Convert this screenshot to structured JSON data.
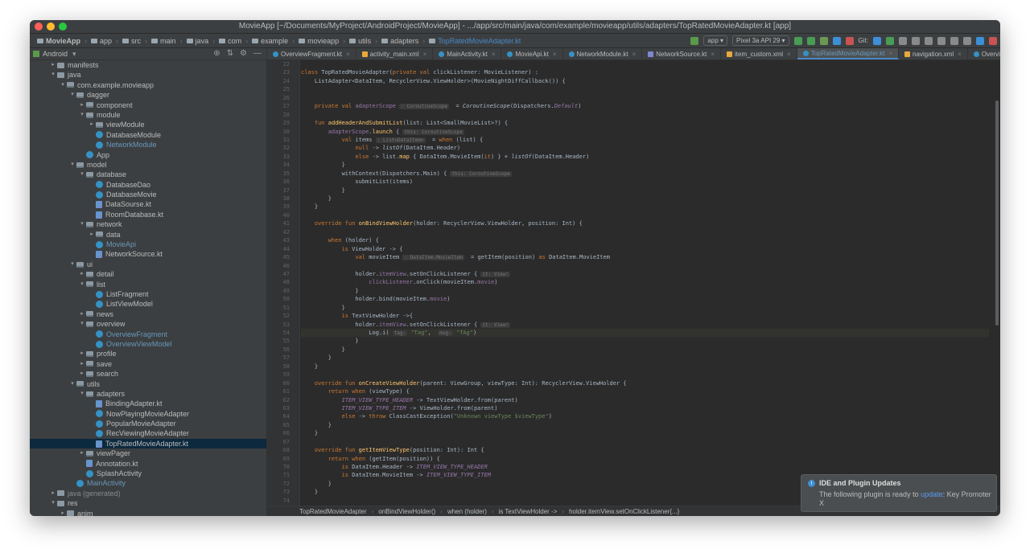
{
  "window": {
    "title": "MovieApp [~/Documents/MyProject/AndroidProject/MovieApp] - .../app/src/main/java/com/example/movieapp/utils/adapters/TopRatedMovieAdapter.kt [app]"
  },
  "nav": {
    "crumbs": [
      "MovieApp",
      "app",
      "src",
      "main",
      "java",
      "com",
      "example",
      "movieapp",
      "utils",
      "adapters",
      "TopRatedMovieAdapter.kt"
    ],
    "run_config": "app",
    "device": "Pixel 3a API 29",
    "git_label": "Git:"
  },
  "project": {
    "view": "Android",
    "tree": [
      {
        "label": "manifests",
        "depth": 1,
        "arrow": "▸",
        "icon": "folder"
      },
      {
        "label": "java",
        "depth": 1,
        "arrow": "▾",
        "icon": "folder"
      },
      {
        "label": "com.example.movieapp",
        "depth": 2,
        "arrow": "▾",
        "icon": "pkg"
      },
      {
        "label": "dagger",
        "depth": 3,
        "arrow": "▾",
        "icon": "pkg"
      },
      {
        "label": "component",
        "depth": 4,
        "arrow": "▸",
        "icon": "pkg"
      },
      {
        "label": "module",
        "depth": 4,
        "arrow": "▾",
        "icon": "pkg"
      },
      {
        "label": "viewModule",
        "depth": 5,
        "arrow": "▸",
        "icon": "pkg"
      },
      {
        "label": "DatabaseModule",
        "depth": 5,
        "arrow": "",
        "icon": "cls"
      },
      {
        "label": "NetworkModule",
        "depth": 5,
        "arrow": "",
        "icon": "cls",
        "color": "blue"
      },
      {
        "label": "App",
        "depth": 4,
        "arrow": "",
        "icon": "cls"
      },
      {
        "label": "model",
        "depth": 3,
        "arrow": "▾",
        "icon": "pkg"
      },
      {
        "label": "database",
        "depth": 4,
        "arrow": "▾",
        "icon": "pkg"
      },
      {
        "label": "DatabaseDao",
        "depth": 5,
        "arrow": "",
        "icon": "cls"
      },
      {
        "label": "DatabaseMovie",
        "depth": 5,
        "arrow": "",
        "icon": "cls"
      },
      {
        "label": "DataSourse.kt",
        "depth": 5,
        "arrow": "",
        "icon": "kt"
      },
      {
        "label": "RoomDatabase.kt",
        "depth": 5,
        "arrow": "",
        "icon": "kt"
      },
      {
        "label": "network",
        "depth": 4,
        "arrow": "▾",
        "icon": "pkg"
      },
      {
        "label": "data",
        "depth": 5,
        "arrow": "▸",
        "icon": "pkg"
      },
      {
        "label": "MovieApi",
        "depth": 5,
        "arrow": "",
        "icon": "cls",
        "color": "blue"
      },
      {
        "label": "NetworkSource.kt",
        "depth": 5,
        "arrow": "",
        "icon": "kt"
      },
      {
        "label": "ui",
        "depth": 3,
        "arrow": "▾",
        "icon": "pkg"
      },
      {
        "label": "detail",
        "depth": 4,
        "arrow": "▸",
        "icon": "pkg"
      },
      {
        "label": "list",
        "depth": 4,
        "arrow": "▾",
        "icon": "pkg"
      },
      {
        "label": "ListFragment",
        "depth": 5,
        "arrow": "",
        "icon": "cls"
      },
      {
        "label": "ListViewModel",
        "depth": 5,
        "arrow": "",
        "icon": "cls"
      },
      {
        "label": "news",
        "depth": 4,
        "arrow": "▸",
        "icon": "pkg"
      },
      {
        "label": "overview",
        "depth": 4,
        "arrow": "▾",
        "icon": "pkg"
      },
      {
        "label": "OverviewFragment",
        "depth": 5,
        "arrow": "",
        "icon": "cls",
        "color": "blue"
      },
      {
        "label": "OverviewViewModel",
        "depth": 5,
        "arrow": "",
        "icon": "cls",
        "color": "blue"
      },
      {
        "label": "profile",
        "depth": 4,
        "arrow": "▸",
        "icon": "pkg"
      },
      {
        "label": "save",
        "depth": 4,
        "arrow": "▸",
        "icon": "pkg"
      },
      {
        "label": "search",
        "depth": 4,
        "arrow": "▸",
        "icon": "pkg"
      },
      {
        "label": "utils",
        "depth": 3,
        "arrow": "▾",
        "icon": "pkg"
      },
      {
        "label": "adapters",
        "depth": 4,
        "arrow": "▾",
        "icon": "pkg"
      },
      {
        "label": "BindingAdapter.kt",
        "depth": 5,
        "arrow": "",
        "icon": "kt"
      },
      {
        "label": "NowPlayingMovieAdapter",
        "depth": 5,
        "arrow": "",
        "icon": "cls"
      },
      {
        "label": "PopularMovieAdapter",
        "depth": 5,
        "arrow": "",
        "icon": "cls"
      },
      {
        "label": "RecViewingMovieAdapter",
        "depth": 5,
        "arrow": "",
        "icon": "cls"
      },
      {
        "label": "TopRatedMovieAdapter.kt",
        "depth": 5,
        "arrow": "",
        "icon": "kt",
        "selected": true
      },
      {
        "label": "viewPager",
        "depth": 4,
        "arrow": "▸",
        "icon": "pkg"
      },
      {
        "label": "Annotation.kt",
        "depth": 4,
        "arrow": "",
        "icon": "kt"
      },
      {
        "label": "SplashActivity",
        "depth": 4,
        "arrow": "",
        "icon": "cls"
      },
      {
        "label": "MainActivity",
        "depth": 3,
        "arrow": "",
        "icon": "cls",
        "color": "blue"
      },
      {
        "label": "java (generated)",
        "depth": 1,
        "arrow": "▸",
        "icon": "folder",
        "color": "gray"
      },
      {
        "label": "res",
        "depth": 1,
        "arrow": "▾",
        "icon": "res"
      },
      {
        "label": "anim",
        "depth": 2,
        "arrow": "▸",
        "icon": "folder"
      }
    ]
  },
  "tabs": [
    {
      "label": "OverviewFragment.kt",
      "icon": "cls"
    },
    {
      "label": "activity_main.xml",
      "icon": "xml"
    },
    {
      "label": "MainActivity.kt",
      "icon": "cls"
    },
    {
      "label": "MovieApi.kt",
      "icon": "cls"
    },
    {
      "label": "NetworkModule.kt",
      "icon": "cls"
    },
    {
      "label": "NetworkSource.kt",
      "icon": "kt"
    },
    {
      "label": "item_custom.xml",
      "icon": "xml"
    },
    {
      "label": "TopRatedMovieAdapter.kt",
      "icon": "cls",
      "active": true
    },
    {
      "label": "navigation.xml",
      "icon": "xml"
    },
    {
      "label": "OverviewViewMo",
      "icon": "cls"
    }
  ],
  "code": [
    {
      "n": "22",
      "html": ""
    },
    {
      "n": "23",
      "html": "<span class='kw'>class</span> TopRatedMovieAdapter(<span class='kw'>private val</span> clickListener: MovieListener) :"
    },
    {
      "n": "24",
      "html": "    ListAdapter&lt;DataItem, RecyclerView.ViewHolder&gt;(MovieNightDiffCallback()) {"
    },
    {
      "n": "25",
      "html": ""
    },
    {
      "n": "26",
      "html": ""
    },
    {
      "n": "27",
      "html": "    <span class='kw'>private val</span> <span class='prop'>adapterScope</span> <span class='hint'>: CoroutineScope</span>  = <span class='it'>CoroutineScope</span>(Dispatchers.<span class='prop it'>Default</span>)"
    },
    {
      "n": "28",
      "html": ""
    },
    {
      "n": "29",
      "html": "    <span class='kw'>fun</span> <span class='fn'>addHeaderAndSubmitList</span>(list: List&lt;SmallMovieList&gt;?) {"
    },
    {
      "n": "30",
      "html": "        <span class='prop'>adapterScope</span>.<span class='fn'>launch</span> { <span class='hint'>this: CoroutineScope</span>"
    },
    {
      "n": "31",
      "html": "            <span class='kw'>val</span> items <span class='hint'>: List&lt;DataItem&gt;</span>  = <span class='kw'>when</span> (list) {"
    },
    {
      "n": "32",
      "html": "                <span class='kw'>null</span> -&gt; <span class='it'>listOf</span>(DataItem.Header)"
    },
    {
      "n": "33",
      "html": "                <span class='kw'>else</span> -&gt; list.<span class='fn'>map</span> { DataItem.MovieItem(<span class='kw'>it</span>) } + <span class='it'>listOf</span>(DataItem.Header)"
    },
    {
      "n": "34",
      "html": "            }"
    },
    {
      "n": "35",
      "html": "            withContext(Dispatchers.Main) { <span class='hint'>this: CoroutineScope</span>"
    },
    {
      "n": "36",
      "html": "                submitList(items)"
    },
    {
      "n": "37",
      "html": "            }"
    },
    {
      "n": "38",
      "html": "        }"
    },
    {
      "n": "39",
      "html": "    }"
    },
    {
      "n": "40",
      "html": ""
    },
    {
      "n": "41",
      "html": "    <span class='kw'>override fun</span> <span class='fn'>onBindViewHolder</span>(holder: RecyclerView.ViewHolder, position: Int) {"
    },
    {
      "n": "42",
      "html": ""
    },
    {
      "n": "43",
      "html": "        <span class='kw'>when</span> (holder) {"
    },
    {
      "n": "44",
      "html": "            <span class='kw'>is</span> ViewHolder -&gt; {"
    },
    {
      "n": "45",
      "html": "                <span class='kw'>val</span> movieItem <span class='hint'>: DataItem.MovieItem</span>  = getItem(position) <span class='kw'>as</span> DataItem.MovieItem"
    },
    {
      "n": "46",
      "html": ""
    },
    {
      "n": "47",
      "html": "                holder.<span class='prop'>itemView</span>.setOnClickListener { <span class='hint'>it: View!</span>"
    },
    {
      "n": "48",
      "html": "                    <span class='prop'>clickListener</span>.onClick(movieItem.<span class='prop'>movie</span>)"
    },
    {
      "n": "49",
      "html": "                }"
    },
    {
      "n": "50",
      "html": "                holder.bind(movieItem.<span class='prop'>movie</span>)"
    },
    {
      "n": "51",
      "html": "            }"
    },
    {
      "n": "52",
      "html": "            <span class='kw'>is</span> TextViewHolder -&gt;{"
    },
    {
      "n": "53",
      "html": "                holder.<span class='prop'>itemView</span>.setOnClickListener { <span class='hint'>it: View!</span>"
    },
    {
      "n": "54",
      "html": "                    Log.i( <span class='hint'>tag:</span> <span class='str'>\"Tag\"</span>,  <span class='hint'>msg:</span> <span class='str'>\"TAg\"</span>)",
      "hl": true
    },
    {
      "n": "55",
      "html": "                }"
    },
    {
      "n": "56",
      "html": "            }"
    },
    {
      "n": "57",
      "html": "        }"
    },
    {
      "n": "58",
      "html": "    }"
    },
    {
      "n": "59",
      "html": ""
    },
    {
      "n": "60",
      "html": "    <span class='kw'>override fun</span> <span class='fn'>onCreateViewHolder</span>(parent: ViewGroup, viewType: Int): RecyclerView.ViewHolder {"
    },
    {
      "n": "61",
      "html": "        <span class='kw'>return when</span> (viewType) {"
    },
    {
      "n": "62",
      "html": "            <span class='prop it'>ITEM_VIEW_TYPE_HEADER</span> -&gt; TextViewHolder.from(parent)"
    },
    {
      "n": "63",
      "html": "            <span class='prop it'>ITEM_VIEW_TYPE_ITEM</span> -&gt; ViewHolder.from(parent)"
    },
    {
      "n": "64",
      "html": "            <span class='kw'>else</span> -&gt; <span class='kw'>throw</span> ClassCastException(<span class='str'>\"Unknown viewType $viewType\"</span>)"
    },
    {
      "n": "65",
      "html": "        }"
    },
    {
      "n": "66",
      "html": "    }"
    },
    {
      "n": "67",
      "html": ""
    },
    {
      "n": "68",
      "html": "    <span class='kw'>override fun</span> <span class='fn'>getItemViewType</span>(position: Int): Int {"
    },
    {
      "n": "69",
      "html": "        <span class='kw'>return when</span> (getItem(position)) {"
    },
    {
      "n": "70",
      "html": "            <span class='kw'>is</span> DataItem.Header -&gt; <span class='prop it'>ITEM_VIEW_TYPE_HEADER</span>"
    },
    {
      "n": "71",
      "html": "            <span class='kw'>is</span> DataItem.MovieItem -&gt; <span class='prop it'>ITEM_VIEW_TYPE_ITEM</span>"
    },
    {
      "n": "72",
      "html": "        }"
    },
    {
      "n": "73",
      "html": "    }"
    },
    {
      "n": "74",
      "html": ""
    }
  ],
  "editor_breadcrumb": [
    "TopRatedMovieAdapter",
    "onBindViewHolder()",
    "when (holder)",
    "is TextViewHolder ->",
    "holder.itemView.setOnClickListener{...}"
  ],
  "notification": {
    "title": "IDE and Plugin Updates",
    "body_prefix": "The following plugin is ready to ",
    "link": "update",
    "body_suffix": ": Key Promoter X"
  }
}
